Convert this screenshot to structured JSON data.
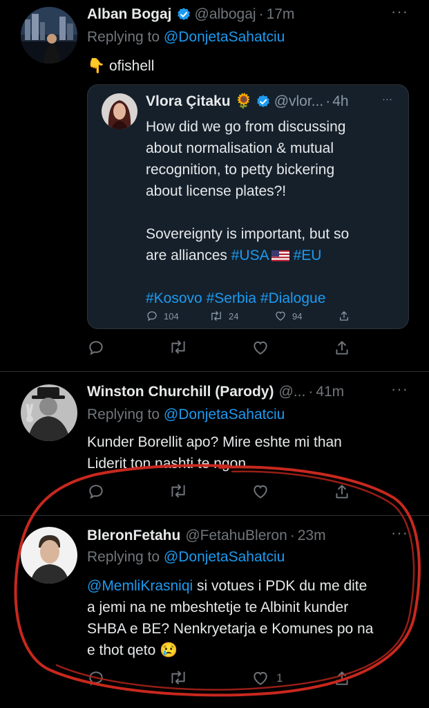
{
  "tweets": [
    {
      "name": "Alban Bogaj",
      "handle": "@albogaj",
      "time": "17m",
      "replying_prefix": "Replying to",
      "replying_to": "@DonjetaSahatciu",
      "emoji": "👇",
      "text": "ofishell",
      "quote": {
        "name": "Vlora Çitaku",
        "emoji": "🌻",
        "handle": "@vlor...",
        "time": "4h",
        "lines": [
          "How did we go from discussing",
          "about normalisation & mutual",
          "recognition, to petty bickering",
          "about license plates?!"
        ],
        "line2a": "Sovereignty is important, but so",
        "line2b_prefix": "are alliances",
        "hashtag_usa": "#USA",
        "hashtag_eu": "#EU",
        "hashtags3": [
          "#Kosovo",
          "#Serbia",
          "#Dialogue"
        ],
        "stats": {
          "replies": "104",
          "retweets": "24",
          "likes": "94"
        }
      }
    },
    {
      "name": "Winston Churchill (Parody)",
      "handle": "@...",
      "time": "41m",
      "replying_prefix": "Replying to",
      "replying_to": "@DonjetaSahatciu",
      "lines": [
        "Kunder Borellit apo? Mire eshte mi than",
        "Liderit ton nashti te ngon."
      ]
    },
    {
      "name": "BleronFetahu",
      "handle": "@FetahuBleron",
      "time": "23m",
      "replying_prefix": "Replying to",
      "replying_to": "@DonjetaSahatciu",
      "mention": "@MemliKrasniqi",
      "line1_rest": "si votues i PDK du me dite",
      "lines": [
        "a jemi na ne mbeshtetje te Albinit kunder",
        "SHBA e BE? Nenkryetarja e Komunes po na"
      ],
      "last_line": "e thot qeto",
      "last_emoji": "😢",
      "likes": "1"
    }
  ],
  "separator": "·",
  "more_glyph": "···",
  "colors": {
    "accent": "#1d9bf0",
    "muted": "#71767b",
    "annotation": "#c8281e"
  }
}
